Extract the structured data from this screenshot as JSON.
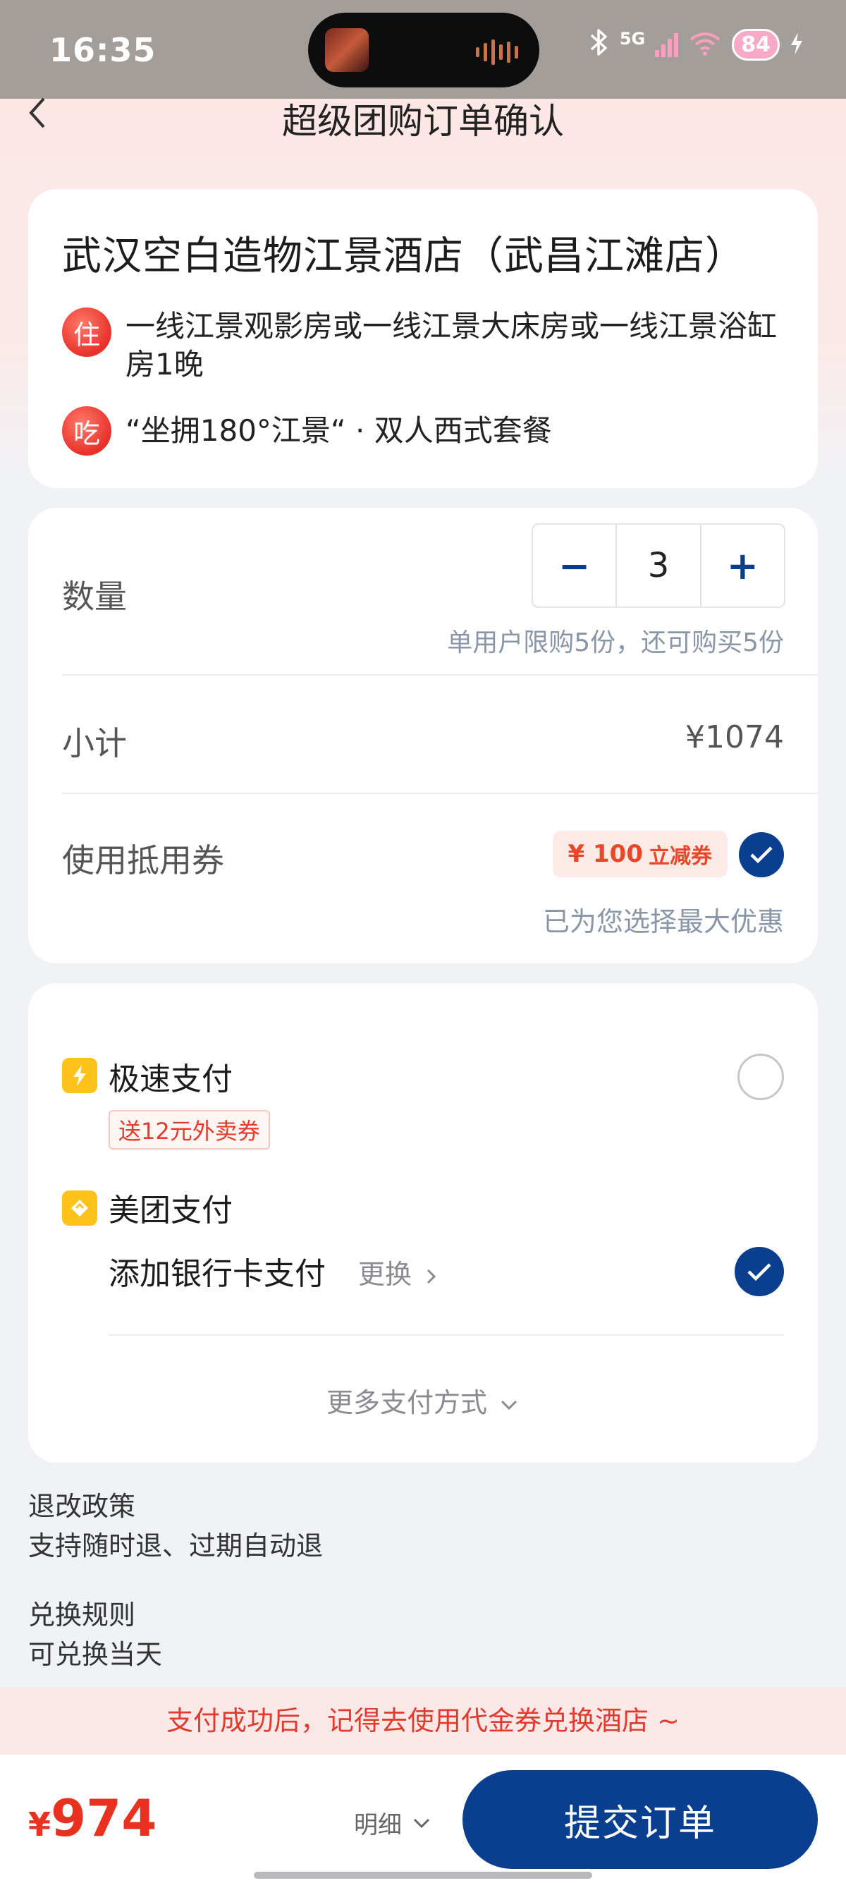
{
  "status_bar": {
    "time": "16:35",
    "network": "5G",
    "battery": "84"
  },
  "nav": {
    "title": "超级团购订单确认"
  },
  "hotel": {
    "name": "武汉空白造物江景酒店（武昌江滩店）",
    "items": [
      {
        "badge": "住",
        "text": "一线江景观影房或一线江景大床房或一线江景浴缸房1晚"
      },
      {
        "badge": "吃",
        "text": "“坐拥180°江景“ · 双人西式套餐"
      }
    ]
  },
  "order": {
    "quantity_label": "数量",
    "quantity": "3",
    "minus": "−",
    "plus": "+",
    "limit_hint": "单用户限购5份，还可购买5份",
    "subtotal_label": "小计",
    "subtotal": "¥1074",
    "coupon_label": "使用抵用券",
    "coupon_amount": "¥ 100",
    "coupon_text": "立减券",
    "coupon_hint": "已为您选择最大优惠"
  },
  "payment": {
    "option1": {
      "name": "极速支付",
      "promo": "送12元外卖券",
      "selected": false
    },
    "option2": {
      "name": "美团支付",
      "sub": "添加银行卡支付",
      "change": "更换",
      "selected": true
    },
    "more": "更多支付方式"
  },
  "policy": {
    "refund_title": "退改政策",
    "refund_text": "支持随时退、过期自动退",
    "exchange_title": "兑换规则",
    "exchange_text": "可兑换当天"
  },
  "notice": "支付成功后，记得去使用代金券兑换酒店 ~",
  "footer": {
    "currency": "¥",
    "total": "974",
    "detail": "明细",
    "submit": "提交订单"
  },
  "colors": {
    "brand_blue": "#0a3e8f",
    "price_red": "#e8311f",
    "badge_red": "#e8312a",
    "pay_yellow": "#ffc21a"
  }
}
